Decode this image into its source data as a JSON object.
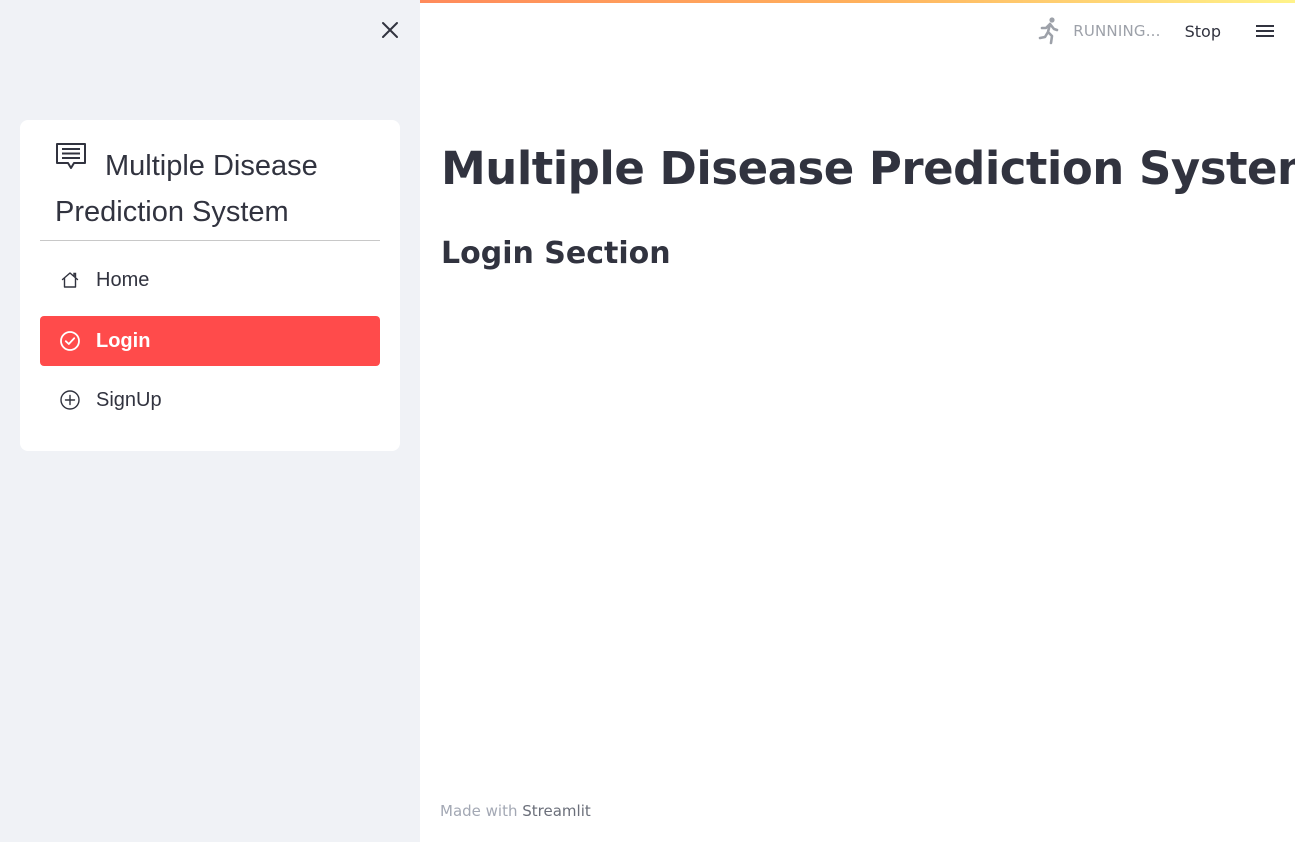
{
  "sidebar": {
    "menu_title": "Multiple Disease Prediction System",
    "items": [
      {
        "label": "Home",
        "icon": "house-icon",
        "selected": false
      },
      {
        "label": "Login",
        "icon": "check-circle-icon",
        "selected": true
      },
      {
        "label": "SignUp",
        "icon": "plus-circle-icon",
        "selected": false
      }
    ]
  },
  "header": {
    "status_text": "RUNNING...",
    "stop_label": "Stop"
  },
  "main": {
    "title": "Multiple Disease Prediction System",
    "section_title": "Login Section"
  },
  "footer": {
    "prefix": "Made with ",
    "brand": "Streamlit"
  },
  "colors": {
    "accent": "#ff4b4b",
    "sidebar_bg": "#f0f2f6",
    "text": "#31333f",
    "muted": "#9da1a9"
  }
}
